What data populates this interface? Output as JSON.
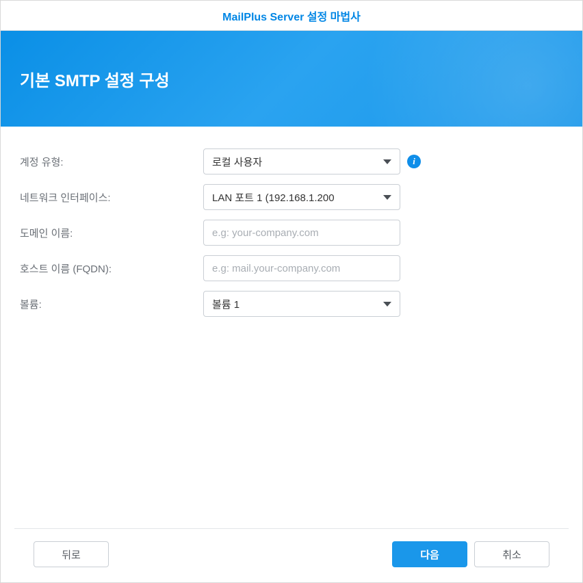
{
  "titlebar": {
    "title": "MailPlus Server 설정 마법사"
  },
  "header": {
    "title": "기본 SMTP 설정 구성"
  },
  "form": {
    "account_type": {
      "label": "계정 유형:",
      "value": "로컬 사용자"
    },
    "network_interface": {
      "label": "네트워크 인터페이스:",
      "value": "LAN 포트 1 (192.168.1.200"
    },
    "domain_name": {
      "label": "도메인 이름:",
      "value": "",
      "placeholder": "e.g: your-company.com"
    },
    "host_name": {
      "label": "호스트 이름 (FQDN):",
      "value": "",
      "placeholder": "e.g: mail.your-company.com"
    },
    "volume": {
      "label": "볼륨:",
      "value": "볼륨 1"
    }
  },
  "footer": {
    "back": "뒤로",
    "next": "다음",
    "cancel": "취소"
  },
  "icons": {
    "info": "i"
  }
}
